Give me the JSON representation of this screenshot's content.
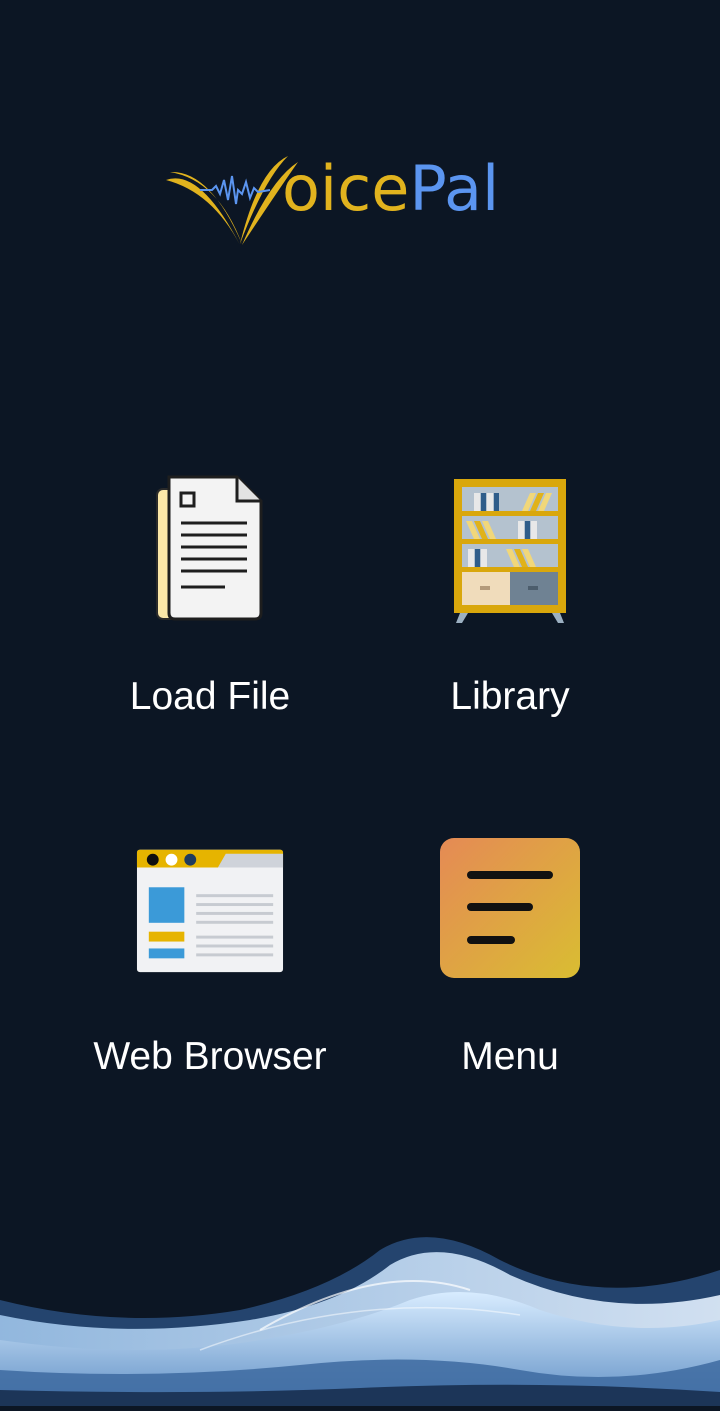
{
  "app": {
    "logo_first_letter": "V",
    "logo_gold_part": "oice",
    "logo_blue_part": "Pal",
    "brand_gold": "#e1b31e",
    "brand_blue": "#5b95f0",
    "background": "#0c1624"
  },
  "tiles": [
    {
      "id": "load-file",
      "label": "Load File",
      "icon": "document-icon"
    },
    {
      "id": "library",
      "label": "Library",
      "icon": "bookshelf-icon"
    },
    {
      "id": "web-browser",
      "label": "Web Browser",
      "icon": "browser-window-icon"
    },
    {
      "id": "menu",
      "label": "Menu",
      "icon": "menu-lines-icon"
    }
  ]
}
